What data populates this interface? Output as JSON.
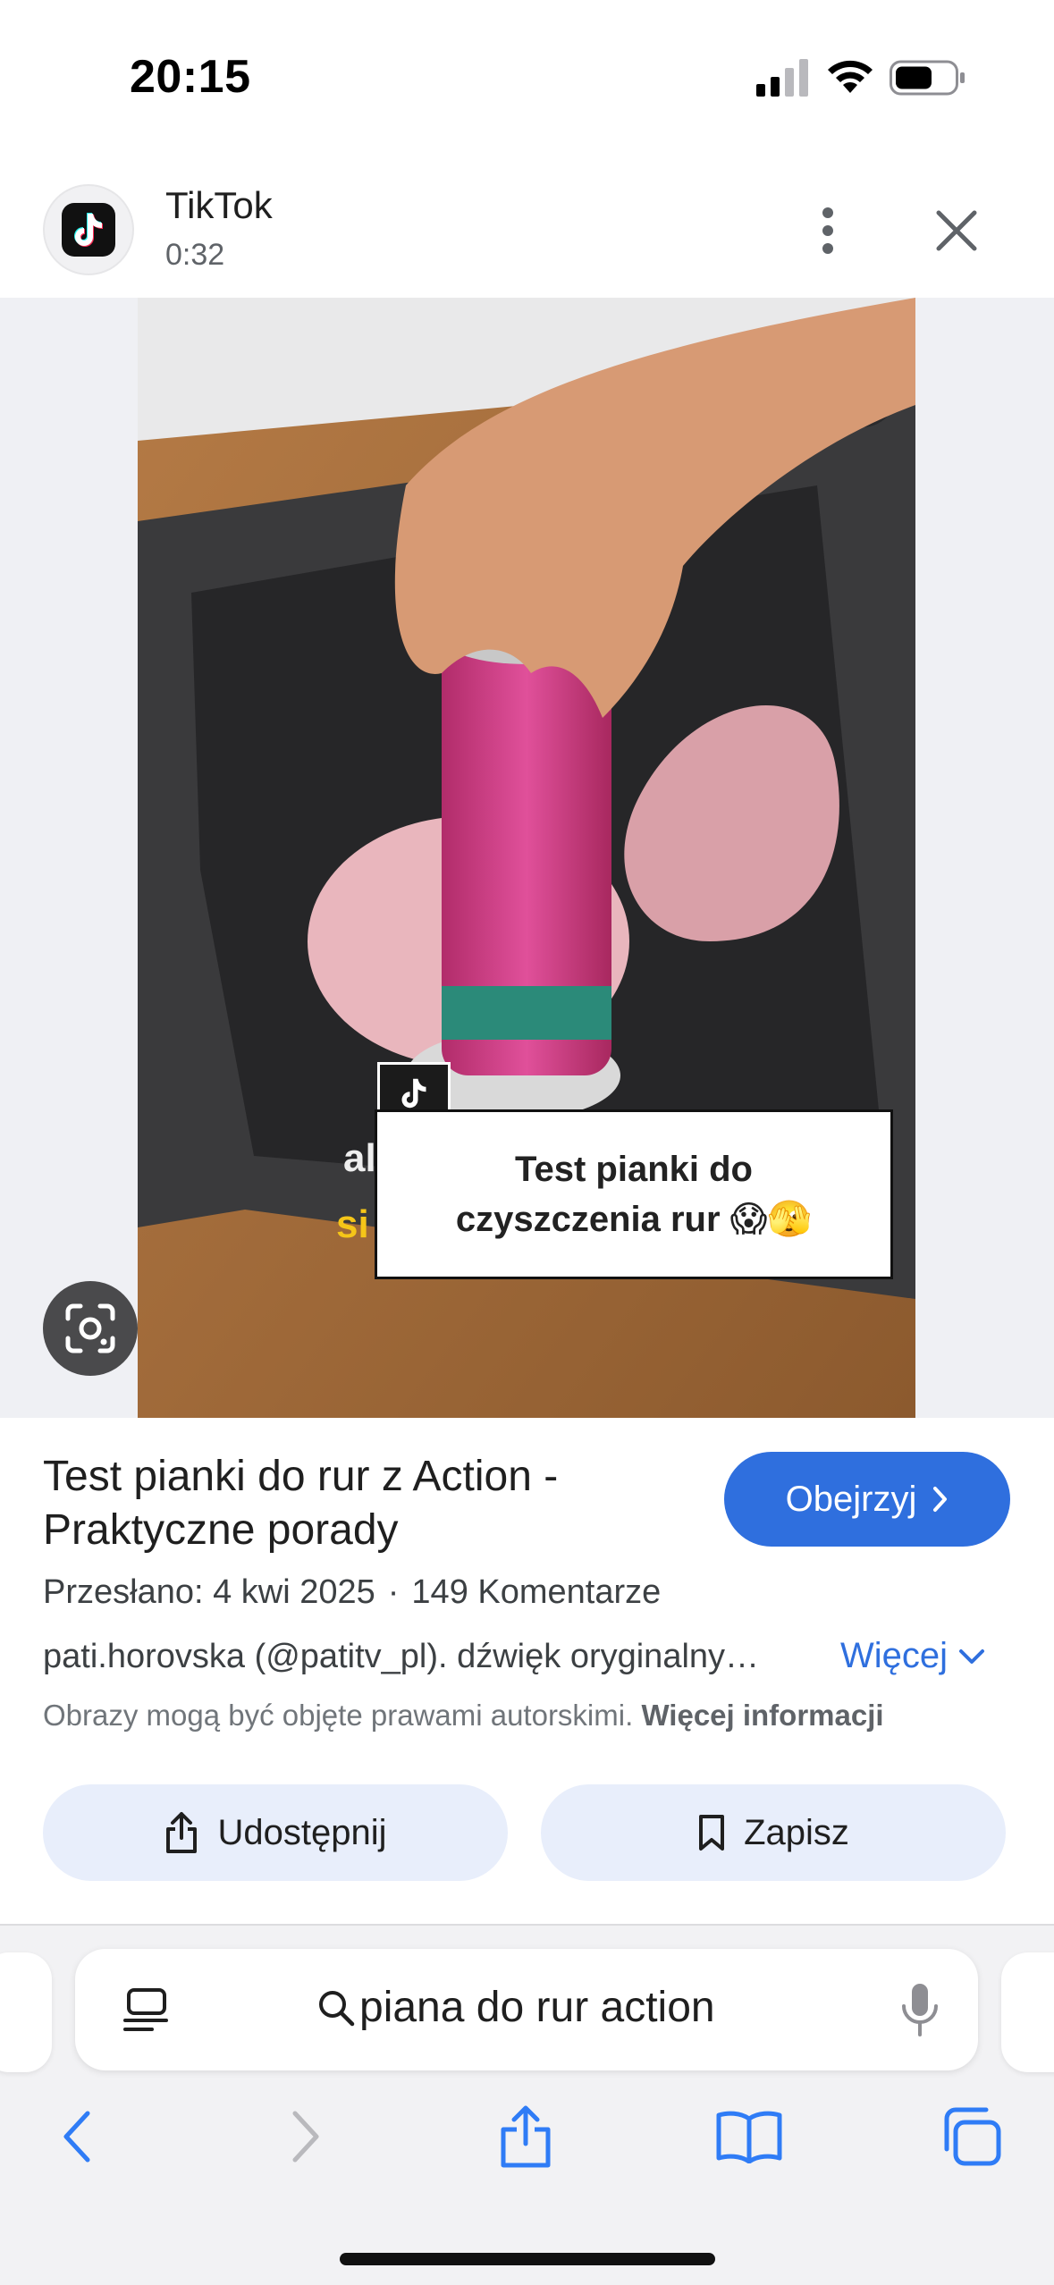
{
  "status_bar": {
    "time": "20:15"
  },
  "header": {
    "source_name": "TikTok",
    "duration": "0:32"
  },
  "video": {
    "caption_lines": [
      "Test pianki do",
      "czyszczenia rur 😱🫣"
    ],
    "partial_left_text": "al",
    "partial_left_text2": "si"
  },
  "result": {
    "title": "Test pianki do rur z Action - Praktyczne porady",
    "watch_label": "Obejrzyj",
    "uploaded": "Przesłano: 4 kwi 2025",
    "separator": "·",
    "comments": "149 Komentarze",
    "author": "pati.horovska (@patitv_pl). dźwięk oryginalny…",
    "more_label": "Więcej",
    "copyright_text": "Obrazy mogą być objęte prawami autorskimi.",
    "copyright_link": "Więcej informacji",
    "share_label": "Udostępnij",
    "save_label": "Zapisz"
  },
  "browser": {
    "search_query": "piana do rur action"
  },
  "colors": {
    "accent": "#2f6fde",
    "action_bg": "#e8eefb",
    "browser_bg": "#f2f2f4"
  }
}
